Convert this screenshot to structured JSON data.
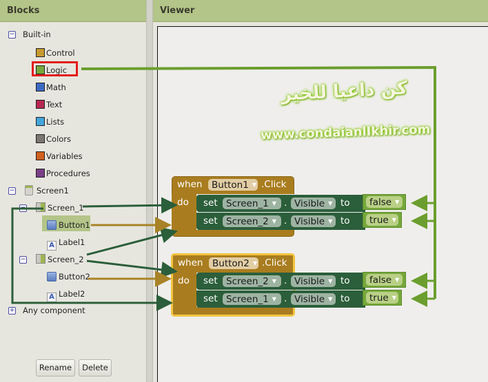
{
  "panels": {
    "blocks_title": "Blocks",
    "viewer_title": "Viewer"
  },
  "tree": {
    "builtin": {
      "label": "Built-in",
      "items": [
        {
          "label": "Control",
          "color": "#c79a2f"
        },
        {
          "label": "Logic",
          "color": "#76a83b"
        },
        {
          "label": "Math",
          "color": "#3c6ac2"
        },
        {
          "label": "Text",
          "color": "#b6294f"
        },
        {
          "label": "Lists",
          "color": "#44a5dc"
        },
        {
          "label": "Colors",
          "color": "#7b7670"
        },
        {
          "label": "Variables",
          "color": "#d0601f"
        },
        {
          "label": "Procedures",
          "color": "#7b3f86"
        }
      ]
    },
    "screen": {
      "label": "Screen1",
      "arrangements": [
        {
          "label": "Screen_1",
          "children": [
            {
              "label": "Button1",
              "type": "button",
              "selected": true
            },
            {
              "label": "Label1",
              "type": "label"
            }
          ]
        },
        {
          "label": "Screen_2",
          "children": [
            {
              "label": "Button2",
              "type": "button"
            },
            {
              "label": "Label2",
              "type": "label"
            }
          ]
        }
      ]
    },
    "any_component": "Any component"
  },
  "buttons": {
    "rename": "Rename",
    "delete": "Delete"
  },
  "watermark": {
    "arabic": "كن داعيا للخير",
    "url": "www.condaianlIkhir.com"
  },
  "event_blocks": [
    {
      "when": "when",
      "component": "Button1",
      "event": ".Click",
      "do": "do",
      "statements": [
        {
          "set": "set",
          "component": "Screen_1",
          "dot": ".",
          "property": "Visible",
          "to": "to",
          "value": "false"
        },
        {
          "set": "set",
          "component": "Screen_2",
          "dot": ".",
          "property": "Visible",
          "to": "to",
          "value": "true"
        }
      ]
    },
    {
      "when": "when",
      "component": "Button2",
      "event": ".Click",
      "do": "do",
      "statements": [
        {
          "set": "set",
          "component": "Screen_2",
          "dot": ".",
          "property": "Visible",
          "to": "to",
          "value": "false"
        },
        {
          "set": "set",
          "component": "Screen_1",
          "dot": ".",
          "property": "Visible",
          "to": "to",
          "value": "true"
        }
      ]
    }
  ],
  "colors": {
    "header": "#b3c588",
    "control_block": "#a97d1f",
    "setter_block": "#2b5e3a",
    "logic_block": "#76a83b",
    "highlight_box": "#e21b1b",
    "selected_item": "#b3c588",
    "annotation_green": "#2b5e3a",
    "annotation_lime": "#6b9e2e",
    "annotation_gold": "#a88227"
  }
}
